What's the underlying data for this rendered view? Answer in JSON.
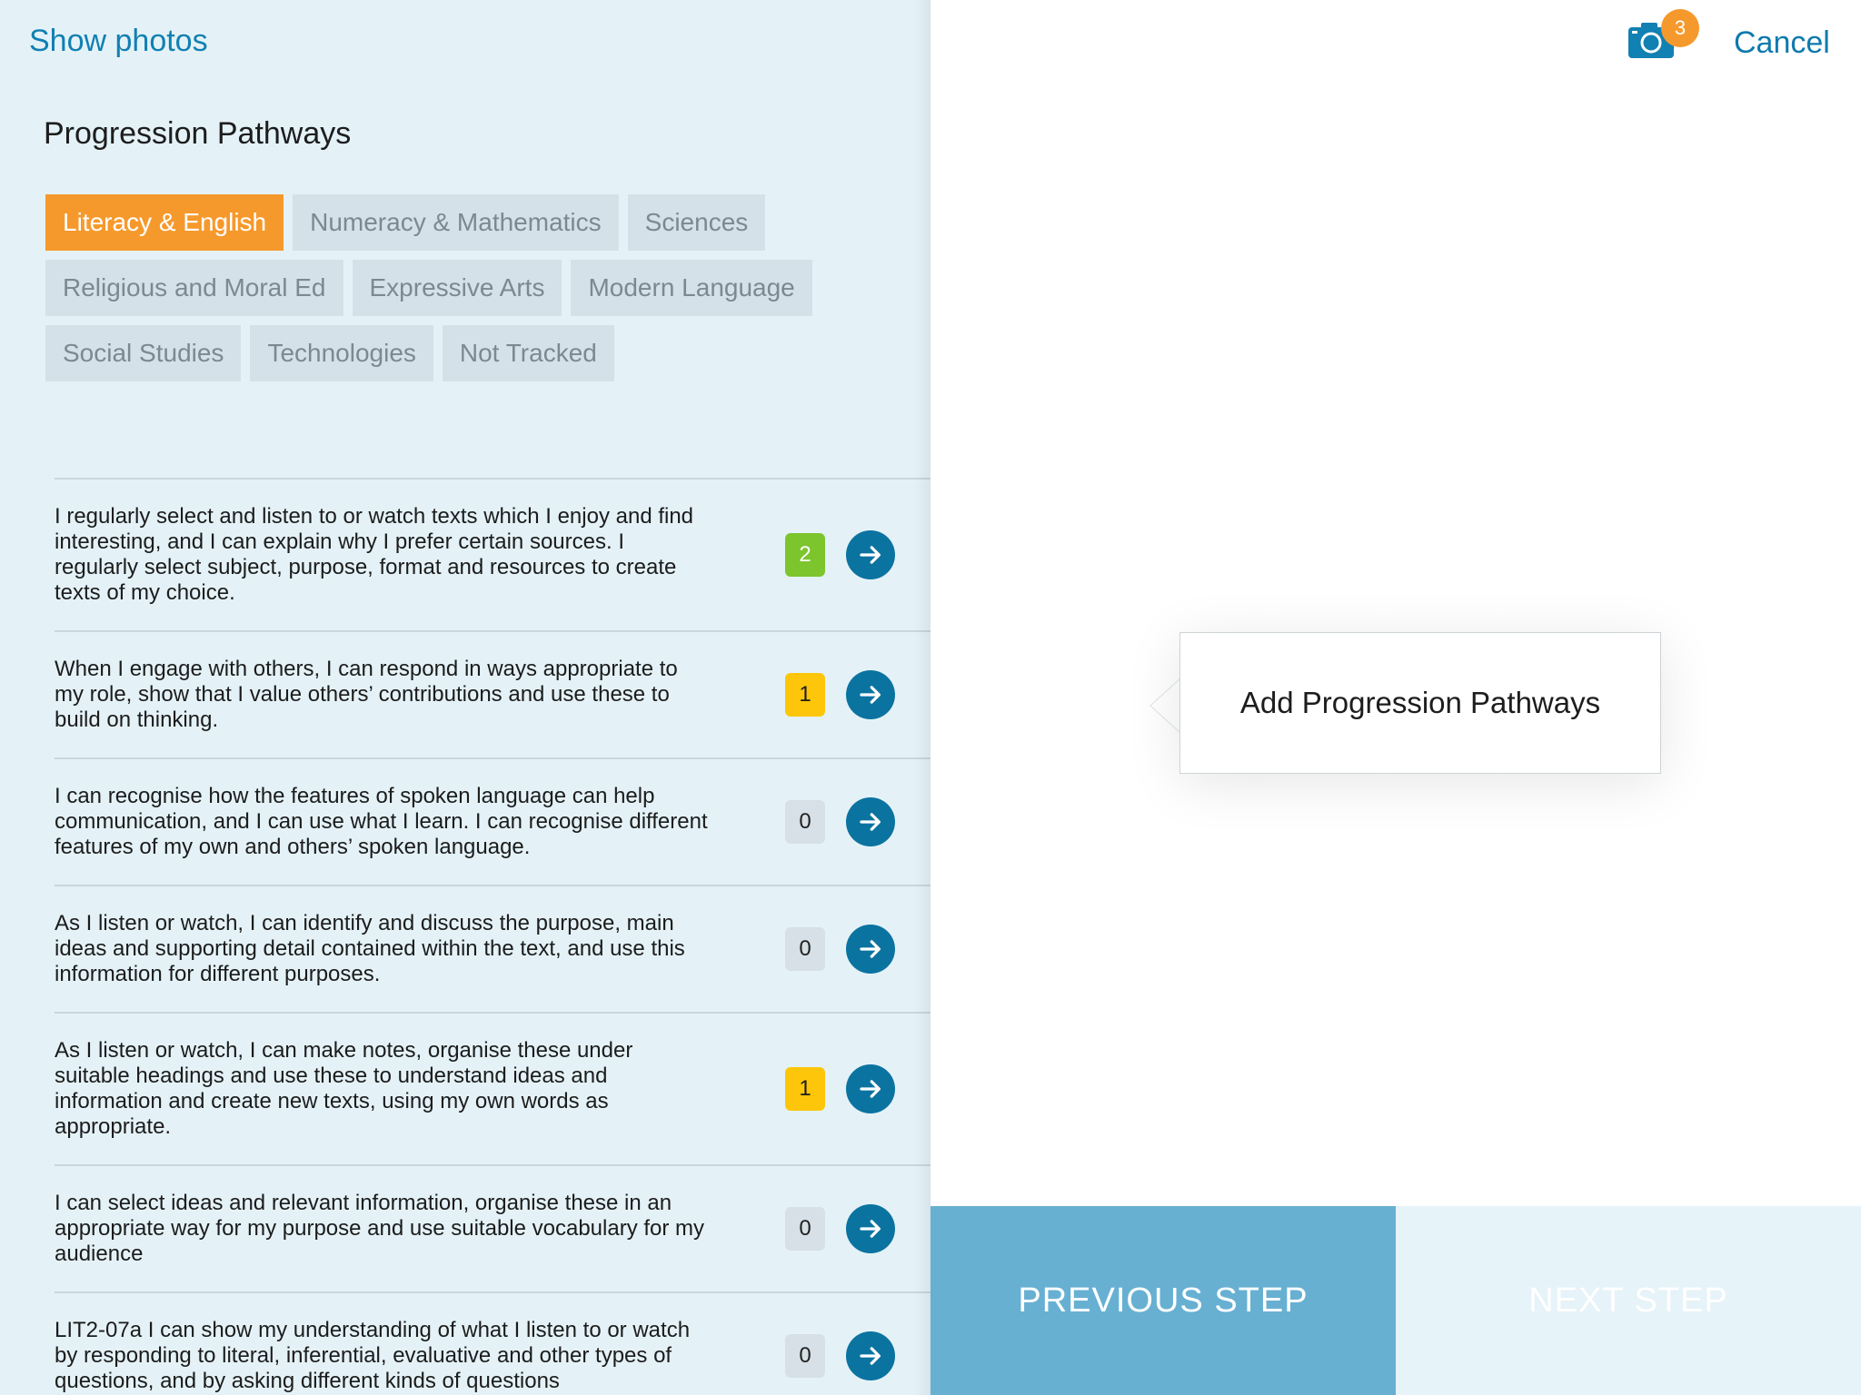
{
  "header": {
    "show_photos": "Show photos",
    "cancel": "Cancel",
    "photo_count": "3"
  },
  "panel": {
    "title": "Progression Pathways",
    "tags": [
      [
        "Literacy & English",
        "Numeracy & Mathematics",
        "Sciences"
      ],
      [
        "Religious and Moral Ed",
        "Expressive Arts",
        "Modern Language"
      ],
      [
        "Social Studies",
        "Technologies",
        "Not Tracked"
      ]
    ],
    "active_tag": "Literacy & English"
  },
  "outcomes": [
    {
      "text": "I regularly select and listen to or watch texts which I enjoy and find interesting, and I can explain why I prefer certain sources. I regularly select subject, purpose, format and resources to create texts of my choice.",
      "count": "2",
      "status": "green"
    },
    {
      "text": "When I engage with others, I can respond in ways appropriate to my role, show that I value others’ contributions and use these to build on thinking.",
      "count": "1",
      "status": "yellow"
    },
    {
      "text": "I can recognise how the features of spoken language can help communication, and I can use what I learn. I can recognise different features of my own and others’ spoken language.",
      "count": "0",
      "status": "none"
    },
    {
      "text": "As I listen or watch, I can identify and discuss the purpose, main ideas and supporting detail contained within the text, and use this information for different purposes.",
      "count": "0",
      "status": "none"
    },
    {
      "text": "As I listen or watch, I can make notes, organise these under suitable headings and use these to understand ideas and information and create new texts, using my own words as appropriate.",
      "count": "1",
      "status": "yellow"
    },
    {
      "text": "I can select ideas and relevant information, organise these in an appropriate way for my purpose and use suitable vocabulary for my audience",
      "count": "0",
      "status": "none"
    },
    {
      "text": "LIT2-07a I can show my understanding of what I listen to or watch by responding to literal, inferential, evaluative and other types of questions, and by asking different kinds of questions",
      "count": "0",
      "status": "none"
    }
  ],
  "popover": {
    "label": "Add Progression Pathways"
  },
  "footer": {
    "previous": "PREVIOUS STEP",
    "next": "NEXT STEP"
  },
  "colors": {
    "accent_orange": "#f6992c",
    "primary_blue": "#0b73a0",
    "status_green": "#7cc52d",
    "status_yellow": "#fdc60a"
  }
}
